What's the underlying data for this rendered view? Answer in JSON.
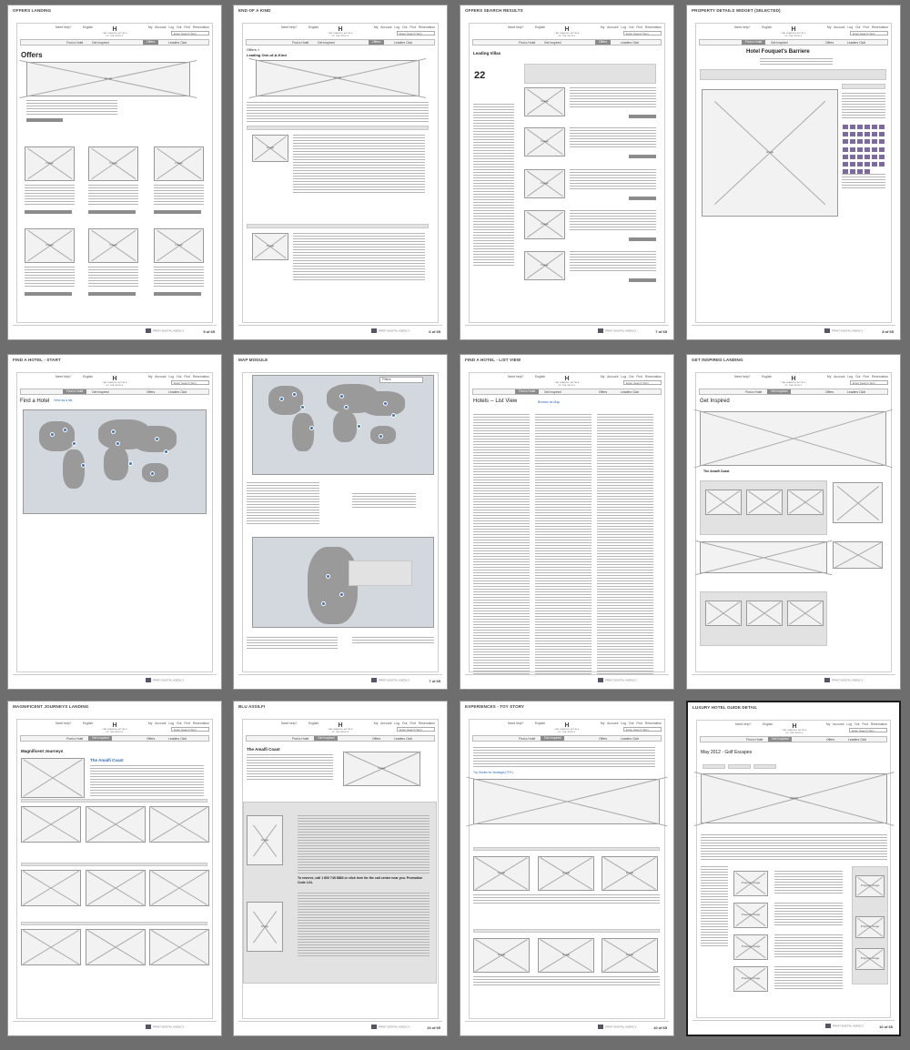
{
  "pages": [
    {
      "title": "OFFERS LANDING",
      "page": "5 of 65",
      "heading": "Offers"
    },
    {
      "title": "END OF A KIND",
      "page": "6 of 65",
      "heading": "Offers >",
      "subheading": "Leading One-of-A-Kind"
    },
    {
      "title": "OFFERS SEARCH RESULTS",
      "page": "7 of 65",
      "heading": "Leading Villas",
      "count": "22"
    },
    {
      "title": "PROPERTY DETAILS WIDGET (SELECTED)",
      "page": "8 of 65",
      "heading": "Hotel Fouquet's Barriere"
    },
    {
      "title": "FIND A HOTEL - START",
      "page": "",
      "heading": "Find a Hotel",
      "sub": "View as a list"
    },
    {
      "title": "MAP MODULE",
      "page": "7 of 65",
      "filter": "Filters"
    },
    {
      "title": "FIND A HOTEL - LIST VIEW",
      "page": "",
      "heading": "Hotels -- List View",
      "sub": "Browse as Map"
    },
    {
      "title": "GET INSPIRED LANDING",
      "page": "",
      "heading": "Get Inspired",
      "carousel": "The Amalfi Coast"
    },
    {
      "title": "MAGNIFICENT JOURNEYS LANDING",
      "page": "",
      "heading": "Magnificent Journeys",
      "sub": "The Amalfi Coast"
    },
    {
      "title": "BLU ASSILFI",
      "page": "13 of 65",
      "heading": "The Amalfi Coast",
      "cta": "To reserve, call 1 800 745 8883 or click here for the call center near you. Promotion Code LOL"
    },
    {
      "title": "EXPERIENCES - TOY STORY",
      "page": "10 of 65",
      "link": "Toy Stories for Nostalgia (TSY)"
    },
    {
      "title": "LUXURY HOTEL GUIDE DETAIL",
      "page": "10 of 65",
      "heading": "May 2012 - Golf Escapes",
      "hero": "HERO",
      "property": "Property Image"
    }
  ],
  "shared": {
    "help": "Need help?",
    "lang": "English",
    "logo": "H",
    "logo_sub": "THE LEADING HOTELS OF THE WORLD",
    "links": "My Account  Log Out  Find Reservation",
    "search": "Enter Search Term",
    "nav": [
      "Find a Hotel",
      "Get Inspired",
      "Offers",
      "Leaders Club"
    ],
    "image": "Image",
    "footer_logo": "PRINT-DIGITAL AGENCY"
  }
}
